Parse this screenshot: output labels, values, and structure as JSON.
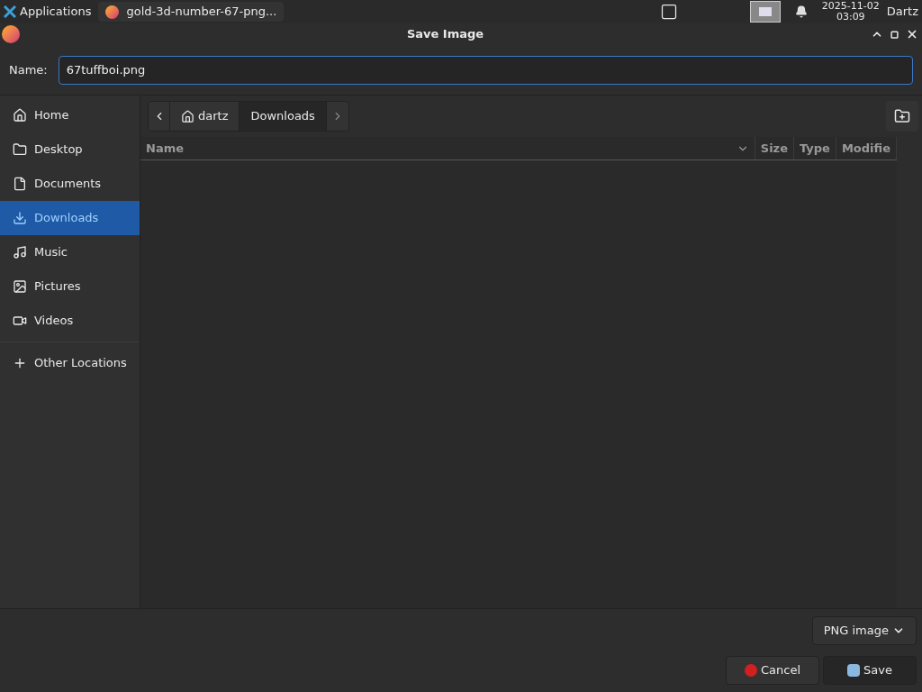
{
  "taskbar": {
    "menu": "Applications",
    "task": "gold-3d-number-67-png...",
    "date": "2025-11-02",
    "time": "03:09",
    "user": "Dartz"
  },
  "window": {
    "title": "Save Image"
  },
  "name_field": {
    "label": "Name:",
    "value": "67tuffboi.png"
  },
  "sidebar": {
    "items": [
      {
        "kind": "home",
        "label": "Home",
        "selected": false
      },
      {
        "kind": "desktop",
        "label": "Desktop",
        "selected": false
      },
      {
        "kind": "documents",
        "label": "Documents",
        "selected": false
      },
      {
        "kind": "downloads",
        "label": "Downloads",
        "selected": true
      },
      {
        "kind": "music",
        "label": "Music",
        "selected": false
      },
      {
        "kind": "pictures",
        "label": "Pictures",
        "selected": false
      },
      {
        "kind": "videos",
        "label": "Videos",
        "selected": false
      }
    ],
    "other": "Other Locations"
  },
  "breadcrumb": [
    {
      "label": "dartz",
      "home": true,
      "selected": false
    },
    {
      "label": "Downloads",
      "home": false,
      "selected": true
    }
  ],
  "table": {
    "columns": [
      "Name",
      "Size",
      "Type",
      "Modifie"
    ]
  },
  "filter": "PNG image",
  "buttons": {
    "cancel": "Cancel",
    "save": "Save"
  }
}
